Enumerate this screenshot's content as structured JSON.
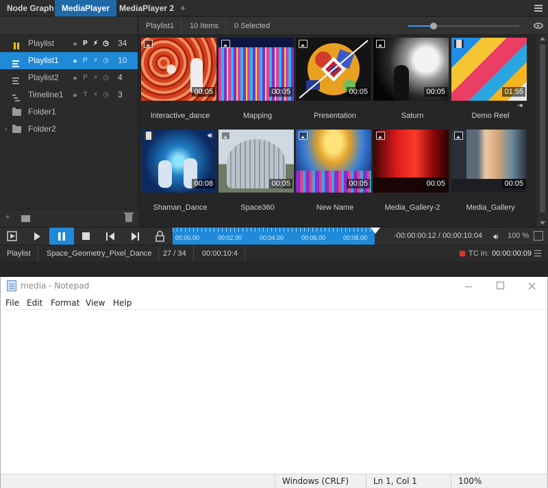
{
  "player": {
    "tabs": [
      "Node Graph",
      "MediaPlayer",
      "MediaPlayer 2"
    ],
    "tab_add": "+",
    "playlists": [
      {
        "name": "Playlist",
        "count": "34",
        "flags": [
          "P"
        ]
      },
      {
        "name": "Playlist1",
        "count": "10",
        "flags": [
          "P"
        ]
      },
      {
        "name": "Playlist2",
        "count": "4",
        "flags": [
          "P"
        ]
      },
      {
        "name": "Timeline1",
        "count": "3",
        "flags": [
          "T"
        ]
      },
      {
        "name": "Folder1"
      },
      {
        "name": "Folder2"
      }
    ],
    "grid_header": {
      "playlist": "Playlist1",
      "items": "10 Items",
      "selected": "0 Selected"
    },
    "media": [
      {
        "label": "Interactive_dance",
        "duration": "00:05",
        "kind": "image"
      },
      {
        "label": "Mapping",
        "duration": "00:05",
        "kind": "image"
      },
      {
        "label": "Presentation",
        "duration": "00:05",
        "kind": "image"
      },
      {
        "label": "Saturn",
        "duration": "00:05",
        "kind": "image"
      },
      {
        "label": "Demo Reel",
        "duration": "01:55",
        "kind": "video"
      },
      {
        "label": "Shaman_Dance",
        "duration": "00:08",
        "kind": "video"
      },
      {
        "label": "Space360",
        "duration": "00:05",
        "kind": "image"
      },
      {
        "label": "New Name",
        "duration": "00:05",
        "kind": "image"
      },
      {
        "label": "Media_Gallery-2",
        "duration": "00:05",
        "kind": "image"
      },
      {
        "label": "Media_Gallery",
        "duration": "00:05",
        "kind": "image"
      }
    ],
    "timeline_ticks": [
      "00:00.00",
      "00:02.00",
      "00:04.00",
      "00:06.00",
      "00:08.00"
    ],
    "timecode": "-00:00:00:12 / 00:00:10:04",
    "volume": "100 %",
    "status": {
      "mode": "Playlist",
      "clip": "Space_Geometry_Pixel_Dance",
      "position": "27 / 34",
      "duration": "00:00:10:4",
      "tc_label": "TC In:",
      "tc_value": "00:00:00:09"
    },
    "colors": {
      "accent": "#1e8ad8",
      "tab_active": "#1e6aa8",
      "rec": "#d9362b"
    }
  },
  "notepad": {
    "title": "media - Notepad",
    "menu": [
      "File",
      "Edit",
      "Format",
      "View",
      "Help"
    ],
    "content": "",
    "status": {
      "encoding": "Windows (CRLF)",
      "position": "Ln 1, Col 1",
      "zoom": "100%"
    }
  }
}
